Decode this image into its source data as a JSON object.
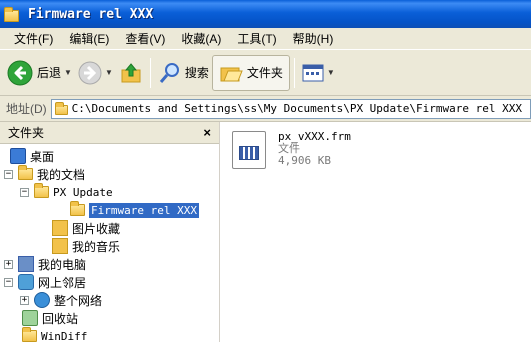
{
  "window": {
    "title": "Firmware rel XXX"
  },
  "menu": [
    "文件(F)",
    "编辑(E)",
    "查看(V)",
    "收藏(A)",
    "工具(T)",
    "帮助(H)"
  ],
  "toolbar": {
    "back_label": "后退",
    "search_label": "搜索",
    "folders_label": "文件夹"
  },
  "address": {
    "label": "地址(D)",
    "path": "C:\\Documents and Settings\\ss\\My Documents\\PX Update\\Firmware rel XXX"
  },
  "panel": {
    "title": "文件夹",
    "close": "×"
  },
  "tree": [
    {
      "label": "桌面",
      "expander": ""
    },
    {
      "label": "我的文档",
      "expander": "−"
    },
    {
      "label": "PX Update",
      "expander": "−"
    },
    {
      "label": "Firmware rel XXX",
      "expander": ""
    },
    {
      "label": "图片收藏",
      "expander": ""
    },
    {
      "label": "我的音乐",
      "expander": ""
    },
    {
      "label": "我的电脑",
      "expander": "+"
    },
    {
      "label": "网上邻居",
      "expander": "−"
    },
    {
      "label": "整个网络",
      "expander": "+"
    },
    {
      "label": "回收站",
      "expander": ""
    },
    {
      "label": "WinDiff",
      "expander": ""
    }
  ],
  "file": {
    "name": "px_vXXX.frm",
    "type": "文件",
    "size": "4,906 KB"
  }
}
